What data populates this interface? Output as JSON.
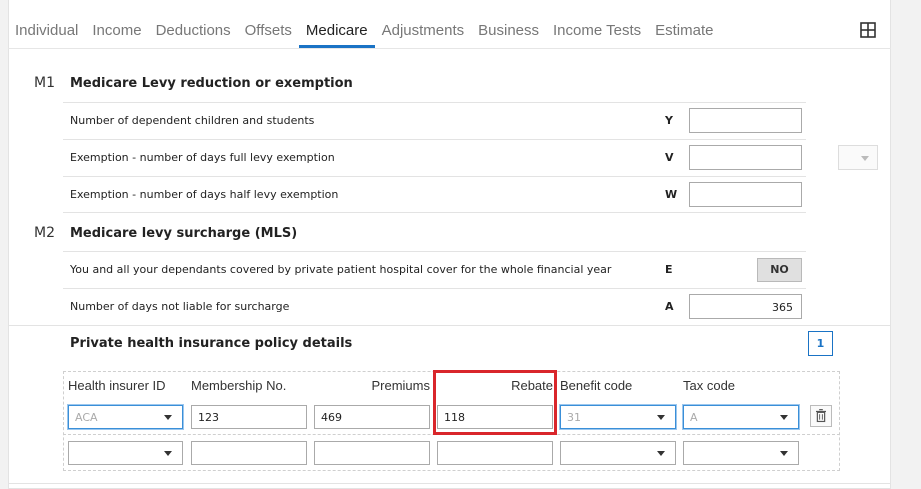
{
  "tabs": [
    {
      "label": "Individual"
    },
    {
      "label": "Income"
    },
    {
      "label": "Deductions"
    },
    {
      "label": "Offsets"
    },
    {
      "label": "Medicare"
    },
    {
      "label": "Adjustments"
    },
    {
      "label": "Business"
    },
    {
      "label": "Income Tests"
    },
    {
      "label": "Estimate"
    }
  ],
  "active_tab": "Medicare",
  "m1": {
    "code": "M1",
    "title": "Medicare Levy reduction or exemption",
    "rows": [
      {
        "label": "Number of dependent children and students",
        "code": "Y",
        "value": ""
      },
      {
        "label": "Exemption - number of days full levy exemption",
        "code": "V",
        "value": ""
      },
      {
        "label": "Exemption - number of days half levy exemption",
        "code": "W",
        "value": ""
      }
    ]
  },
  "m2": {
    "code": "M2",
    "title": "Medicare levy surcharge (MLS)",
    "rows": [
      {
        "label": "You and all your dependants covered by private patient hospital cover for the whole financial year",
        "code": "E",
        "value": "NO"
      },
      {
        "label": "Number of days not liable for surcharge",
        "code": "A",
        "value": "365"
      }
    ]
  },
  "policy": {
    "title": "Private health insurance policy details",
    "count": "1",
    "columns": [
      "Health insurer ID",
      "Membership No.",
      "Premiums",
      "Rebate",
      "Benefit code",
      "Tax code"
    ],
    "rows": [
      {
        "insurer_id": "ACA",
        "membership_no": "123",
        "premiums": "469",
        "rebate": "118",
        "benefit_code": "31",
        "tax_code": "A"
      },
      {
        "insurer_id": "",
        "membership_no": "",
        "premiums": "",
        "rebate": "",
        "benefit_code": "",
        "tax_code": ""
      }
    ]
  },
  "colors": {
    "accent": "#1a73c5",
    "highlight": "#d9262b"
  }
}
